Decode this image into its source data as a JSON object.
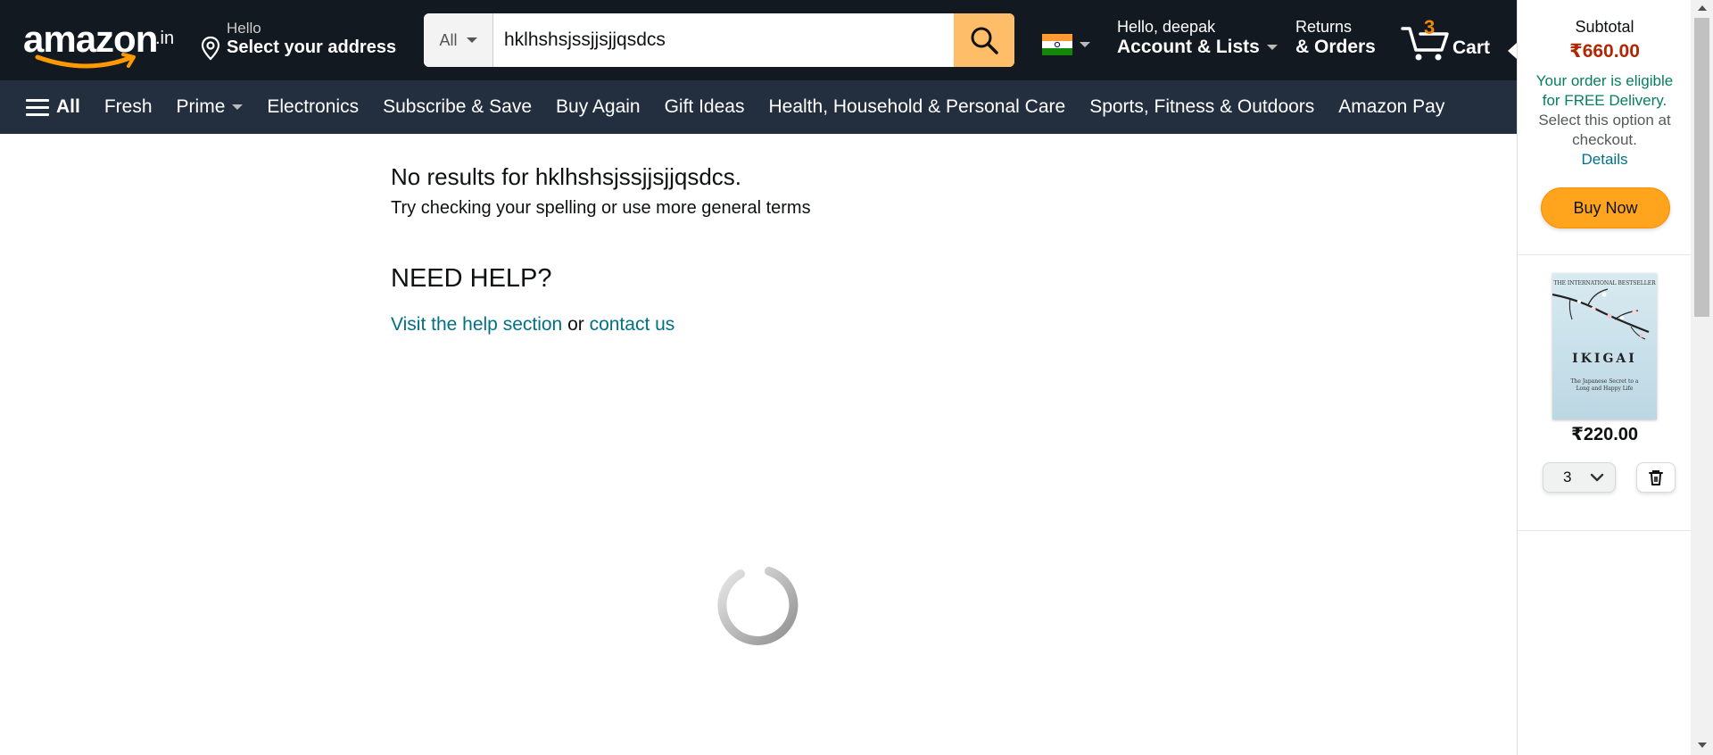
{
  "header": {
    "logo_text": "amazon",
    "logo_tld": ".in",
    "address_hello": "Hello",
    "address_select": "Select your address",
    "search_category": "All",
    "search_query": "hklhshsjssjjsjjqsdcs",
    "account_greeting": "Hello, deepak",
    "account_lists": "Account & Lists",
    "returns": "Returns",
    "orders": "& Orders",
    "cart_count": "3",
    "cart_label": "Cart"
  },
  "nav": {
    "all": "All",
    "items": [
      "Fresh",
      "Prime",
      "Electronics",
      "Subscribe & Save",
      "Buy Again",
      "Gift Ideas",
      "Health, Household & Personal Care",
      "Sports, Fitness & Outdoors",
      "Amazon Pay"
    ]
  },
  "results": {
    "no_results_prefix": "No results for ",
    "query": "hklhshsjssjjsjjqsdcs",
    "query_suffix": ".",
    "hint": "Try checking your spelling or use more general terms",
    "need_help": "NEED HELP?",
    "help_link": "Visit the help section",
    "or": " or ",
    "contact_link": "contact us"
  },
  "cart_flyout": {
    "subtotal_label": "Subtotal",
    "subtotal_amount": "₹660.00",
    "free_delivery_green": "Your order is eligible for FREE Delivery.",
    "free_delivery_gray": " Select this option at checkout.",
    "details_link": "Details",
    "buy_now": "Buy Now",
    "item": {
      "cover_top": "THE INTERNATIONAL BESTSELLER",
      "cover_title": "IKIGAI",
      "cover_subtitle": "The Japanese Secret to a Long and Happy Life",
      "price": "₹220.00",
      "quantity": "3"
    }
  },
  "colors": {
    "header_bg": "#131921",
    "nav_bg": "#232f3e",
    "search_button": "#febd69",
    "link": "#007185",
    "price_red": "#b12704",
    "free_delivery_green": "#067d62",
    "buy_now": "#ffa41c",
    "cart_count": "#f08804"
  },
  "icons": {
    "location": "location-pin-icon",
    "search": "magnifier-icon",
    "flag": "india-flag-icon",
    "cart": "shopping-cart-icon",
    "menu": "hamburger-icon",
    "delete": "trash-icon",
    "loading": "spinner-icon"
  }
}
